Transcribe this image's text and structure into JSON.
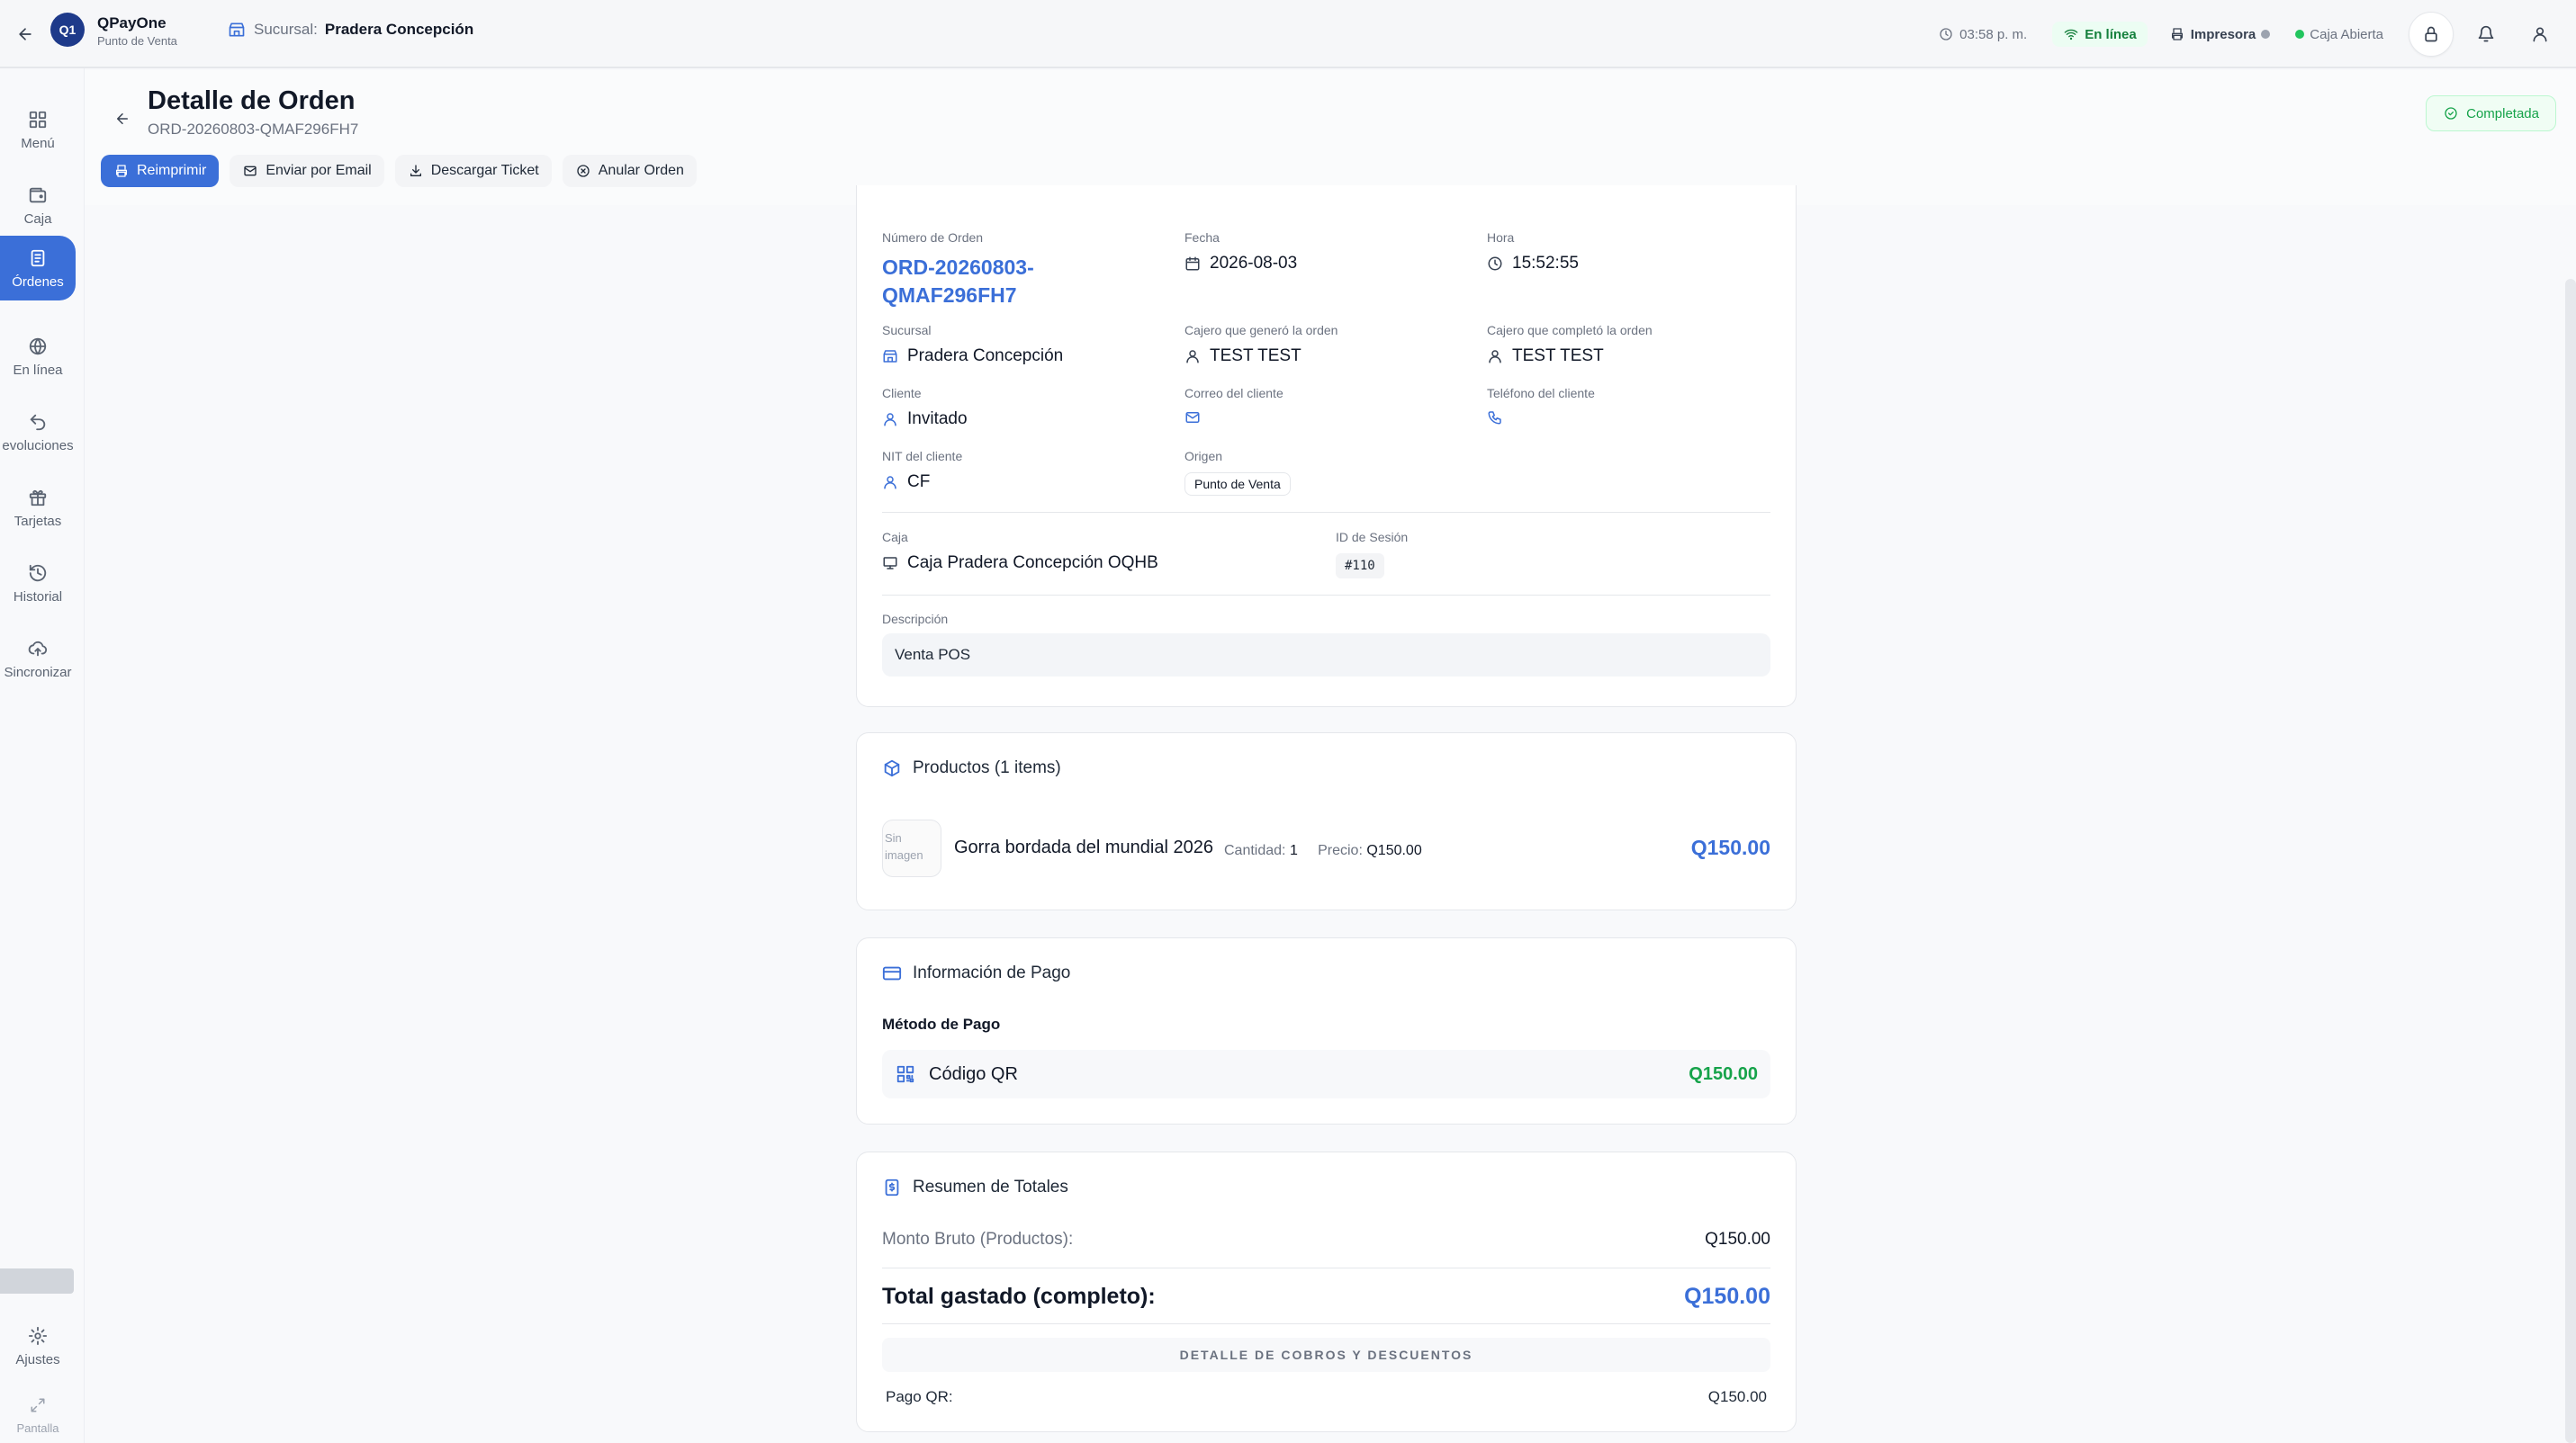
{
  "app": {
    "logo": "Q1",
    "name": "QPayOne",
    "subtitle": "Punto de Venta"
  },
  "branch": {
    "label": "Sucursal:",
    "name": "Pradera Concepción"
  },
  "status_bar": {
    "time": "03:58 p. m.",
    "online": "En línea",
    "printer": "Impresora",
    "register": "Caja Abierta",
    "online_color": "#16a34a",
    "printer_dot_color": "#9ca3af",
    "register_dot_color": "#22c55e"
  },
  "sidebar": {
    "items": [
      {
        "label": "Menú",
        "icon": "grid-icon"
      },
      {
        "label": "Caja",
        "icon": "wallet-icon"
      },
      {
        "label": "Órdenes",
        "icon": "receipt-icon"
      },
      {
        "label": "En línea",
        "icon": "globe-icon"
      },
      {
        "label": "evoluciones",
        "icon": "undo-icon"
      },
      {
        "label": "Tarjetas",
        "icon": "gift-icon"
      },
      {
        "label": "Historial",
        "icon": "history-icon"
      },
      {
        "label": "Sincronizar",
        "icon": "cloud-upload-icon"
      }
    ],
    "settings": "Ajustes",
    "fullscreen": "Pantalla"
  },
  "header": {
    "title": "Detalle de Orden",
    "order_id": "ORD-20260803-QMAF296FH7",
    "status": "Completada"
  },
  "actions": {
    "reprint": "Reimprimir",
    "email": "Enviar por Email",
    "download": "Descargar Ticket",
    "void": "Anular Orden"
  },
  "order_info": {
    "order_number_label": "Número de Orden",
    "order_number_line1": "ORD-20260803-",
    "order_number_line2": "QMAF296FH7",
    "date_label": "Fecha",
    "date": "2026-08-03",
    "time_label": "Hora",
    "time": "15:52:55",
    "branch_label": "Sucursal",
    "branch": "Pradera Concepción",
    "cashier_created_label": "Cajero que generó la orden",
    "cashier_created": "TEST TEST",
    "cashier_completed_label": "Cajero que completó la orden",
    "cashier_completed": "TEST TEST",
    "client_label": "Cliente",
    "client": "Invitado",
    "client_email_label": "Correo del cliente",
    "client_phone_label": "Teléfono del cliente",
    "nit_label": "NIT del cliente",
    "nit": "CF",
    "origin_label": "Origen",
    "origin": "Punto de Venta",
    "register_label": "Caja",
    "register": "Caja Pradera Concepción OQHB",
    "session_label": "ID de Sesión",
    "session": "#110",
    "description_label": "Descripción",
    "description": "Venta POS"
  },
  "products": {
    "title": "Productos (1 items)",
    "items": [
      {
        "thumb_line1": "Sin",
        "thumb_line2": "imagen",
        "name": "Gorra bordada del mundial 2026",
        "qty_label": "Cantidad:",
        "qty": "1",
        "price_label": "Precio:",
        "price": "Q150.00",
        "total": "Q150.00"
      }
    ]
  },
  "payment": {
    "title": "Información de Pago",
    "method_label": "Método de Pago",
    "method": "Código QR",
    "amount": "Q150.00"
  },
  "totals": {
    "title": "Resumen de Totales",
    "gross_label": "Monto Bruto (Productos):",
    "gross": "Q150.00",
    "total_label": "Total gastado (completo):",
    "total": "Q150.00",
    "detail_header": "DETALLE DE COBROS Y DESCUENTOS",
    "qr_label": "Pago QR:",
    "qr_amount": "Q150.00"
  }
}
